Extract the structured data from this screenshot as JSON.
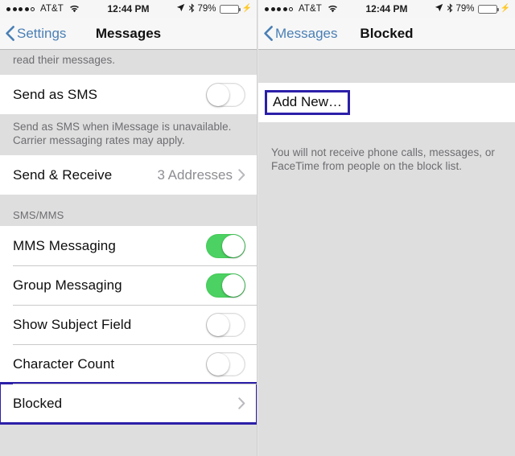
{
  "statusbar": {
    "signal_dots_filled": 4,
    "signal_dots_total": 5,
    "carrier": "AT&T",
    "wifi_icon": "wifi-icon",
    "time": "12:44 PM",
    "location_icon": "location-arrow-icon",
    "bluetooth_icon": "bluetooth-icon",
    "battery_percent": "79%",
    "battery_level": 79,
    "charging_icon": "lightning-bolt-icon",
    "battery_color": "#34cc3c"
  },
  "left_panel": {
    "navbar": {
      "back_label": "Settings",
      "back_icon": "chevron-left-icon",
      "title": "Messages",
      "tint_color": "#4a7fb5"
    },
    "top_footnote_partial": "read their messages.",
    "send_as_sms": {
      "label": "Send as SMS",
      "toggle_state": "off"
    },
    "send_as_sms_footnote": "Send as SMS when iMessage is unavailable. Carrier messaging rates may apply.",
    "send_receive": {
      "label": "Send & Receive",
      "value": "3 Addresses",
      "chevron_icon": "chevron-right-icon"
    },
    "sms_mms_header": "SMS/MMS",
    "sms_mms_rows": [
      {
        "label": "MMS Messaging",
        "type": "toggle",
        "toggle_state": "on"
      },
      {
        "label": "Group Messaging",
        "type": "toggle",
        "toggle_state": "on"
      },
      {
        "label": "Show Subject Field",
        "type": "toggle",
        "toggle_state": "off"
      },
      {
        "label": "Character Count",
        "type": "toggle",
        "toggle_state": "off"
      },
      {
        "label": "Blocked",
        "type": "nav",
        "chevron_icon": "chevron-right-icon",
        "highlighted": true
      }
    ]
  },
  "right_panel": {
    "navbar": {
      "back_label": "Messages",
      "back_icon": "chevron-left-icon",
      "title": "Blocked",
      "tint_color": "#4a7fb5"
    },
    "add_new": {
      "label": "Add New…",
      "highlighted": true
    },
    "footnote": "You will not receive phone calls, messages, or FaceTime from people on the block list."
  },
  "annotation": {
    "highlight_color": "#2b1fa8"
  }
}
